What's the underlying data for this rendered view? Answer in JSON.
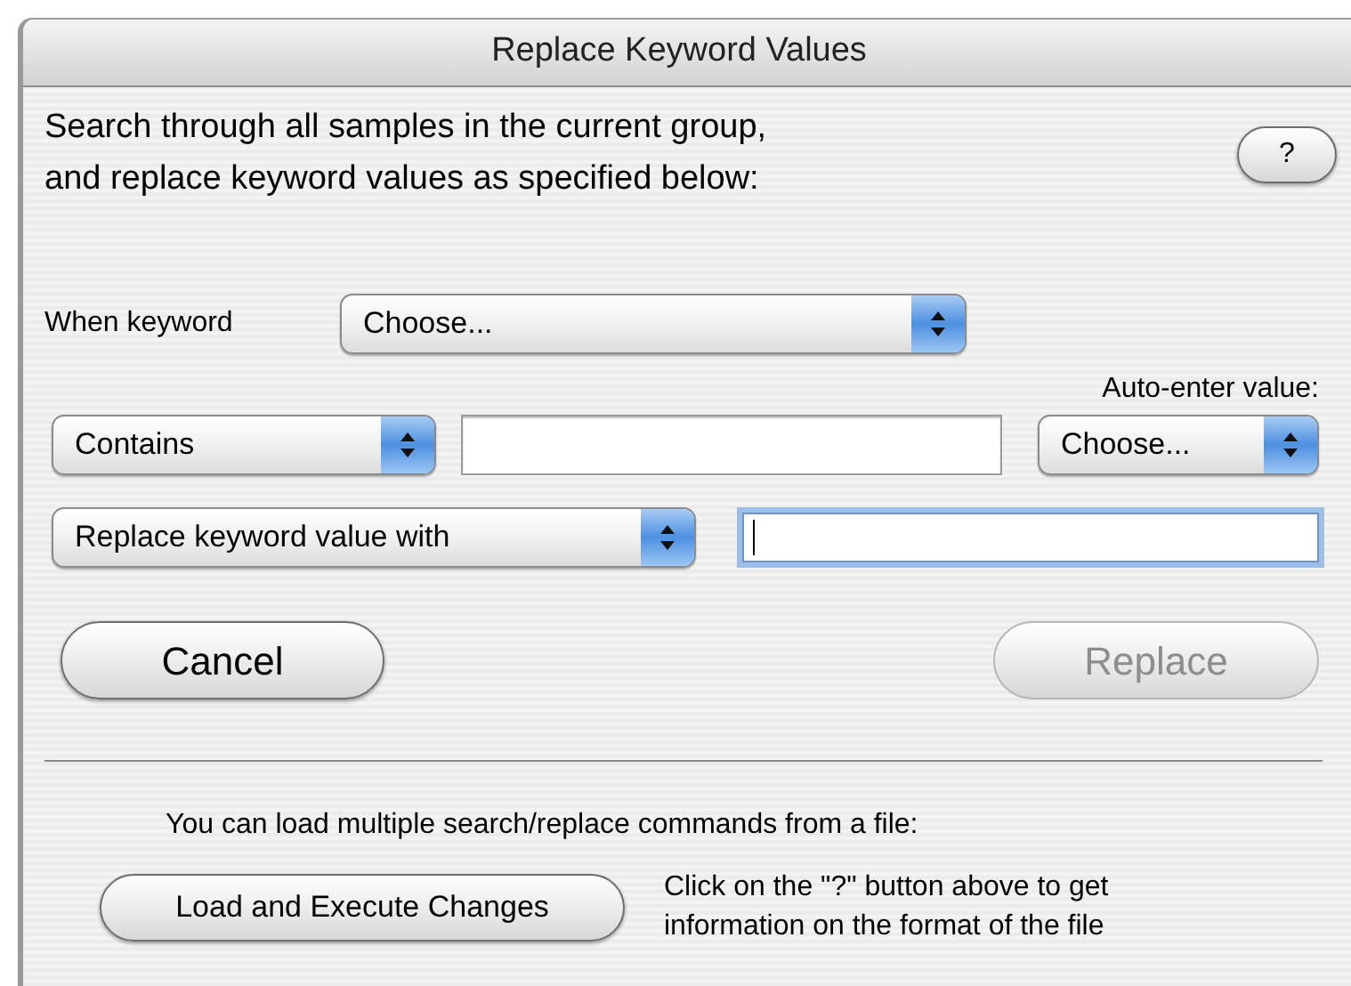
{
  "window": {
    "title": "Replace Keyword Values"
  },
  "description": [
    "Search through all samples in the current group,",
    "and replace keyword values as specified below:"
  ],
  "help_button": {
    "label": "?"
  },
  "when_keyword": {
    "label": "When keyword",
    "popup": {
      "value": "Choose..."
    }
  },
  "auto_enter": {
    "label": "Auto-enter value:",
    "popup": {
      "value": "Choose..."
    }
  },
  "match": {
    "popup": {
      "value": "Contains"
    },
    "field": {
      "focused": false
    }
  },
  "replace_with": {
    "popup": {
      "value": "Replace keyword value with"
    },
    "field": {
      "focused": true
    }
  },
  "buttons": [
    {
      "label": "Cancel",
      "disabled": false
    },
    {
      "label": "Replace",
      "disabled": true
    }
  ],
  "load_note": "You can load multiple search/replace commands from a file:",
  "load_button": {
    "label": "Load and Execute Changes",
    "disabled": false
  },
  "help_note": [
    "Click on the \"?\" button above to get",
    "information on the format of the file"
  ]
}
